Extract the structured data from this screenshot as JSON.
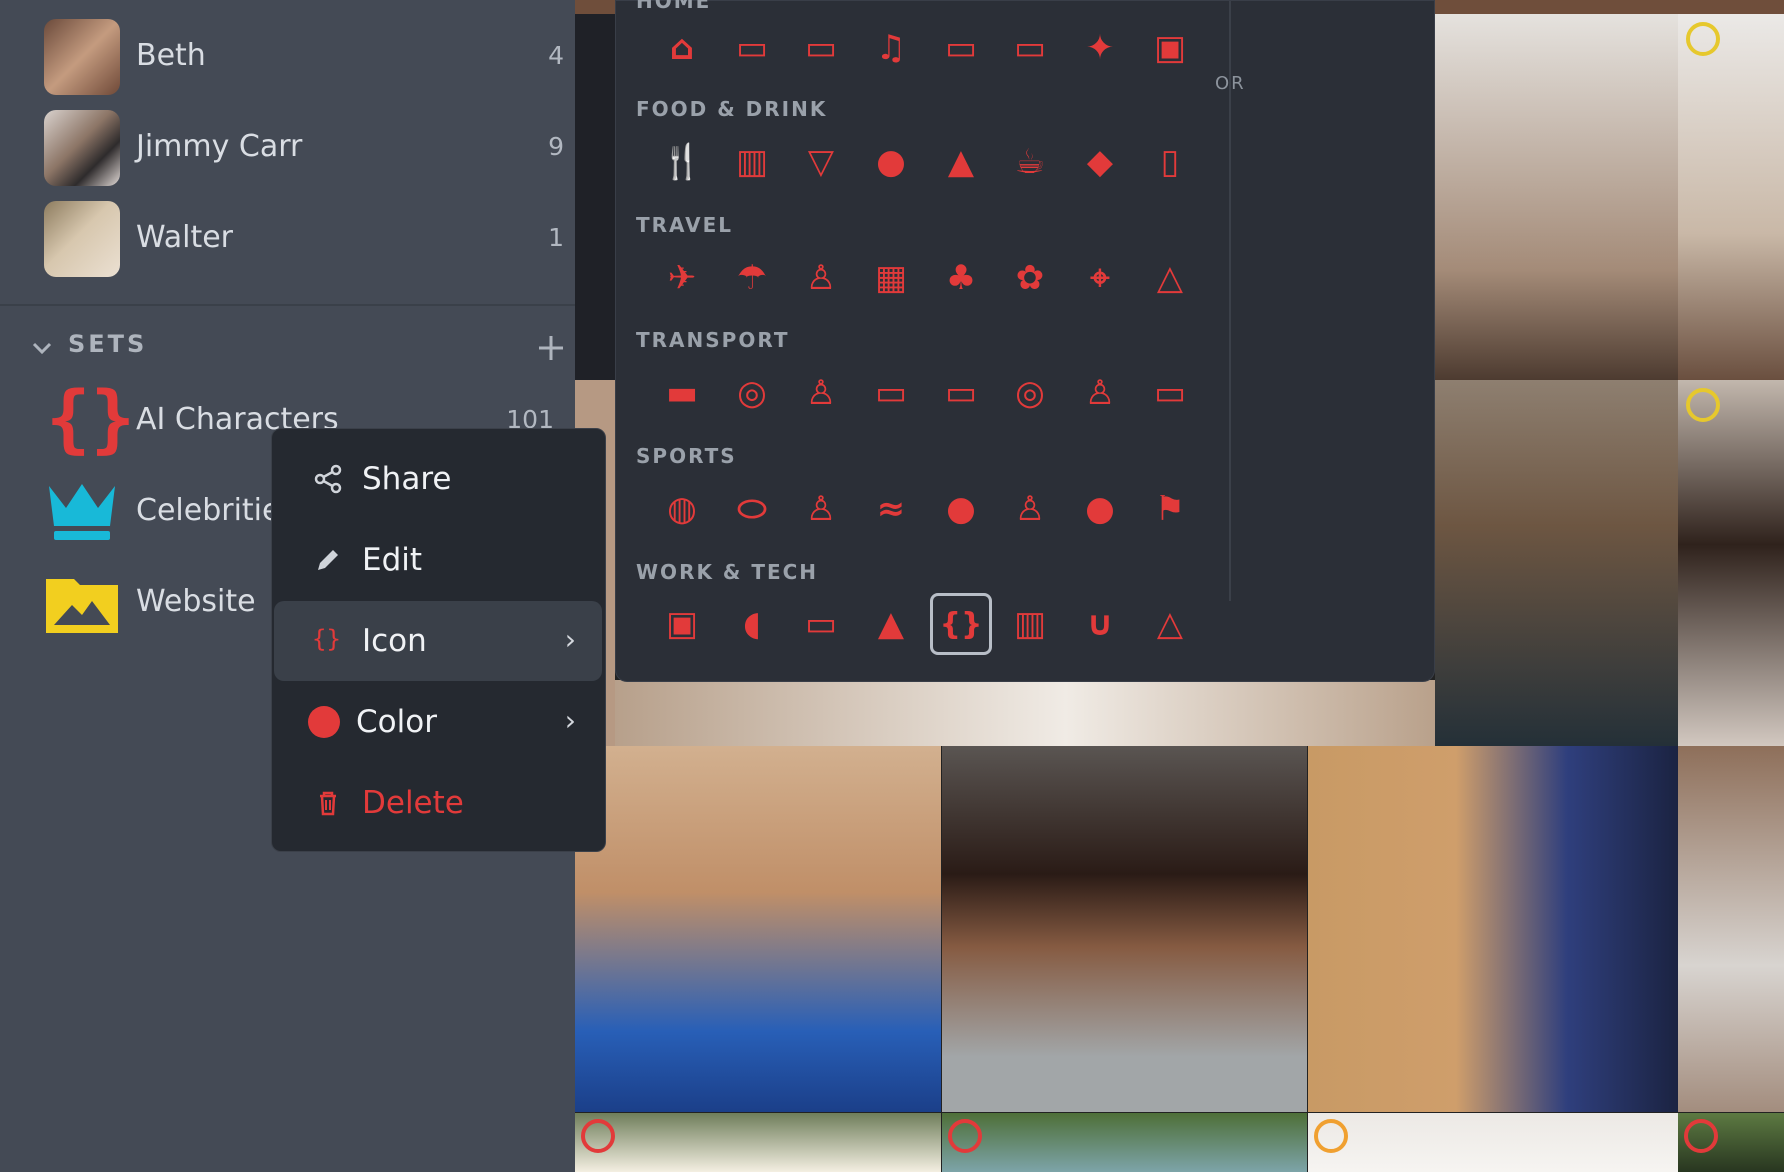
{
  "people": [
    {
      "name": "Beth",
      "count": "4"
    },
    {
      "name": "Jimmy Carr",
      "count": "9"
    },
    {
      "name": "Walter",
      "count": "1"
    }
  ],
  "sets": {
    "title": "SETS",
    "items": [
      {
        "name": "AI Characters",
        "count": "101",
        "icon": "braces-icon",
        "color": "#e23a3a"
      },
      {
        "name": "Celebritie",
        "icon": "crown-icon",
        "color": "#18b9d8"
      },
      {
        "name": "Website",
        "icon": "image-folder-icon",
        "color": "#f2cf1f"
      }
    ]
  },
  "icon_picker": {
    "top_hint": "HOME",
    "or_label": "OR",
    "categories": [
      {
        "name": "FOOD & DRINK",
        "icons": [
          "utensils-icon",
          "glass-icon",
          "cocktail-icon",
          "apple-icon",
          "cake-icon",
          "coffee-icon",
          "pizza-icon",
          "cup-icon"
        ]
      },
      {
        "name": "TRAVEL",
        "icons": [
          "plane-icon",
          "beach-umbrella-icon",
          "hiker-icon",
          "building-icon",
          "tree-icon",
          "flower-icon",
          "map-pin-icon",
          "tent-icon"
        ]
      },
      {
        "name": "TRANSPORT",
        "icons": [
          "car-icon",
          "bicycle-icon",
          "runner-icon",
          "bus-icon",
          "train-icon",
          "motorcycle-icon",
          "walker-icon",
          "tram-icon"
        ]
      },
      {
        "name": "SPORTS",
        "icons": [
          "basketball-icon",
          "football-icon",
          "weightlifter-icon",
          "swimmer-icon",
          "table-tennis-icon",
          "skier-icon",
          "bowling-ball-icon",
          "golf-icon"
        ]
      },
      {
        "name": "WORK & TECH",
        "icons": [
          "briefcase-icon",
          "gamepad-icon",
          "monitor-icon",
          "graduation-cap-icon",
          "braces-icon",
          "bar-chart-icon",
          "stethoscope-icon",
          "flask-icon"
        ]
      }
    ],
    "home_icons": [
      "home-icon",
      "bed-icon",
      "sofa-icon",
      "music-icon",
      "tv-icon",
      "bath-icon",
      "lamp-icon",
      "fireplace-icon"
    ]
  },
  "context_menu": {
    "share": "Share",
    "edit": "Edit",
    "icon": "Icon",
    "color": "Color",
    "delete": "Delete"
  }
}
